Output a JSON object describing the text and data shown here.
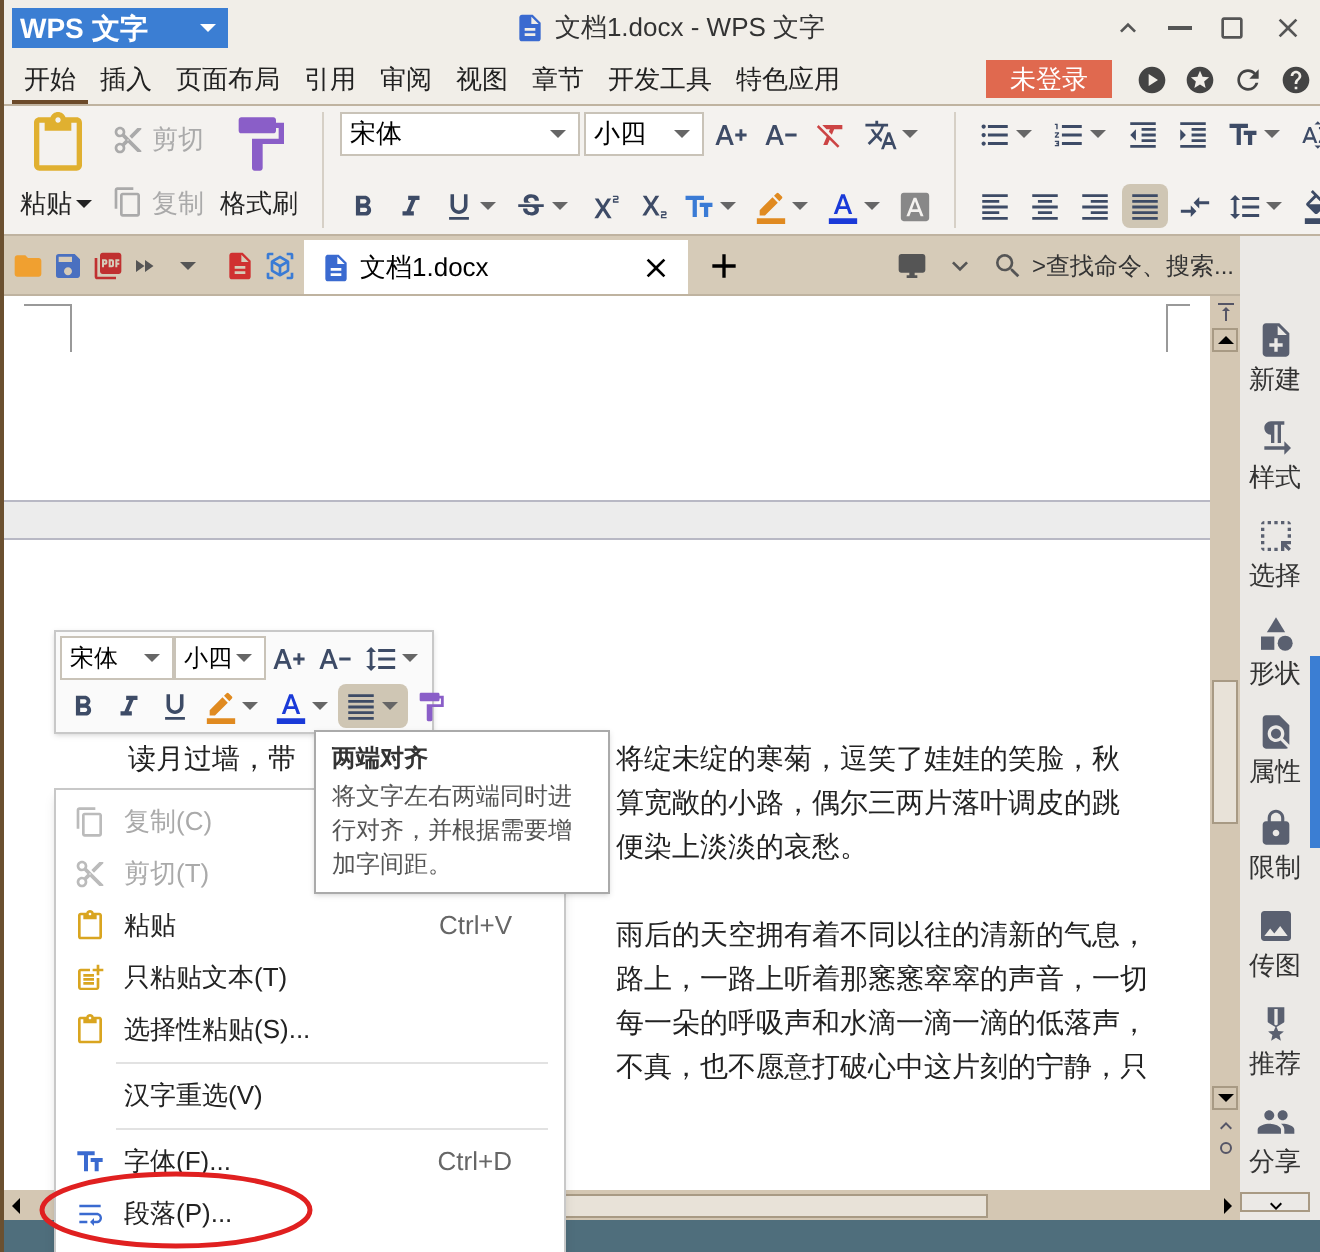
{
  "window": {
    "app_button": "WPS 文字",
    "title": "文档1.docx - WPS 文字"
  },
  "menu_tabs": [
    {
      "label": "开始",
      "selected": true
    },
    {
      "label": "插入",
      "selected": false
    },
    {
      "label": "页面布局",
      "selected": false
    },
    {
      "label": "引用",
      "selected": false
    },
    {
      "label": "审阅",
      "selected": false
    },
    {
      "label": "视图",
      "selected": false
    },
    {
      "label": "章节",
      "selected": false
    },
    {
      "label": "开发工具",
      "selected": false
    },
    {
      "label": "特色应用",
      "selected": false
    }
  ],
  "login_button": "未登录",
  "ribbon": {
    "clipboard": [
      {
        "kind": "paste",
        "label": "粘贴",
        "disabled": false
      },
      {
        "kind": "cut",
        "label": "剪切",
        "disabled": true
      },
      {
        "kind": "copy",
        "label": "复制",
        "disabled": true
      },
      {
        "kind": "format_painter",
        "label": "格式刷",
        "disabled": false
      }
    ],
    "font": "宋体",
    "size": "小四",
    "align_buttons": [
      {
        "kind": "left",
        "selected": false
      },
      {
        "kind": "center",
        "selected": false
      },
      {
        "kind": "right",
        "selected": false
      },
      {
        "kind": "justify",
        "selected": true
      },
      {
        "kind": "distributed",
        "selected": false
      }
    ]
  },
  "doc_tabs": [
    {
      "label": "文档1.docx",
      "selected": true
    }
  ],
  "search": {
    "placeholder": ">查找命令、搜索..."
  },
  "document": {
    "paragraphs": [
      {
        "lines": [
          {
            "segments": [
              "读月过墙，带",
              "将绽未绽的寒菊，逗笑了娃娃的笑脸，秋"
            ]
          },
          {
            "segments": [
              "算宽敞的小路，偶尔三两片落叶调皮的跳"
            ]
          },
          {
            "segments": [
              "便染上淡淡的哀愁。"
            ]
          }
        ]
      },
      {
        "lines": [
          {
            "segments": [
              "雨后的天空拥有着不同以往的清新的气息，"
            ]
          },
          {
            "segments": [
              "路上，一路上听着那窸窸窣窣的声音，一切"
            ]
          },
          {
            "segments": [
              "每一朵的呼吸声和水滴一滴一滴的低落声，"
            ]
          },
          {
            "segments": [
              "不真，也不愿意打破心中这片刻的宁静，只"
            ]
          }
        ]
      }
    ]
  },
  "mini_toolbar": {
    "font": "宋体",
    "size": "小四",
    "justify": {
      "selected": true
    }
  },
  "tooltip": {
    "title": "两端对齐",
    "text": "将文字左右两端同时进行对齐，并根据需要增加字间距。"
  },
  "context_menu": [
    {
      "kind": "copy",
      "label": "复制(C)",
      "disabled": true
    },
    {
      "kind": "cut",
      "label": "剪切(T)",
      "disabled": true
    },
    {
      "kind": "paste",
      "label": "粘贴",
      "shortcut": "Ctrl+V",
      "disabled": false
    },
    {
      "kind": "paste_text",
      "label": "只粘贴文本(T)",
      "disabled": false
    },
    {
      "kind": "paste_special",
      "label": "选择性粘贴(S)...",
      "disabled": false
    },
    {
      "kind": "separator"
    },
    {
      "kind": "plain",
      "label": "汉字重选(V)",
      "disabled": false
    },
    {
      "kind": "separator"
    },
    {
      "kind": "font",
      "label": "字体(F)...",
      "shortcut": "Ctrl+D",
      "disabled": false
    },
    {
      "kind": "paragraph",
      "label": "段落(P)...",
      "disabled": false,
      "circled": true
    }
  ],
  "side_panel": [
    {
      "kind": "new",
      "label": "新建"
    },
    {
      "kind": "style",
      "label": "样式"
    },
    {
      "kind": "select",
      "label": "选择"
    },
    {
      "kind": "shape",
      "label": "形状"
    },
    {
      "kind": "properties",
      "label": "属性"
    },
    {
      "kind": "restrict",
      "label": "限制"
    },
    {
      "kind": "image",
      "label": "传图"
    },
    {
      "kind": "recommend",
      "label": "推荐"
    },
    {
      "kind": "share",
      "label": "分享"
    }
  ]
}
